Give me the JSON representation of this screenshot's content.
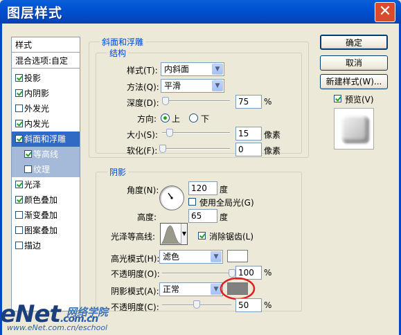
{
  "window": {
    "title": "图层样式",
    "close_glyph": "✕"
  },
  "left_list": {
    "header": "样式",
    "blend": "混合选项:自定",
    "items": [
      {
        "label": "投影",
        "checked": true,
        "state": "normal"
      },
      {
        "label": "内阴影",
        "checked": true,
        "state": "normal"
      },
      {
        "label": "外发光",
        "checked": false,
        "state": "normal"
      },
      {
        "label": "内发光",
        "checked": true,
        "state": "normal"
      },
      {
        "label": "斜面和浮雕",
        "checked": true,
        "state": "selected"
      },
      {
        "label": "等高线",
        "checked": true,
        "state": "sub"
      },
      {
        "label": "纹理",
        "checked": false,
        "state": "sub"
      },
      {
        "label": "光泽",
        "checked": true,
        "state": "normal"
      },
      {
        "label": "颜色叠加",
        "checked": true,
        "state": "normal"
      },
      {
        "label": "渐变叠加",
        "checked": false,
        "state": "normal"
      },
      {
        "label": "图案叠加",
        "checked": false,
        "state": "normal"
      },
      {
        "label": "描边",
        "checked": false,
        "state": "normal"
      }
    ]
  },
  "bevel": {
    "group_title": "斜面和浮雕",
    "structure_title": "结构",
    "style_label": "样式(T):",
    "style_value": "内斜面",
    "technique_label": "方法(Q):",
    "technique_value": "平滑",
    "depth_label": "深度(D):",
    "depth_value": "75",
    "depth_unit": "%",
    "direction_label": "方向:",
    "dir_up": "上",
    "dir_down": "下",
    "size_label": "大小(S):",
    "size_value": "15",
    "size_unit": "像素",
    "soften_label": "软化(F):",
    "soften_value": "0",
    "soften_unit": "像素"
  },
  "shading": {
    "title": "阴影",
    "angle_label": "角度(N):",
    "angle_value": "120",
    "angle_unit": "度",
    "global_light_label": "使用全局光(G)",
    "altitude_label": "高度:",
    "altitude_value": "65",
    "altitude_unit": "度",
    "gloss_label": "光泽等高线:",
    "antialias_label": "消除锯齿(L)",
    "highlight_mode_label": "高光模式(H):",
    "highlight_mode_value": "滤色",
    "highlight_opacity_label": "不透明度(O):",
    "highlight_opacity_value": "100",
    "shadow_mode_label": "阴影模式(A):",
    "shadow_mode_value": "正常",
    "shadow_opacity_label": "不透明度(C):",
    "shadow_opacity_value": "50",
    "percent": "%",
    "highlight_color": "#ffffff",
    "shadow_color": "#808080",
    "annotation_color": "#e02020"
  },
  "buttons": {
    "ok": "确定",
    "cancel": "取消",
    "new_style": "新建样式(W)...",
    "preview_label": "预览(V)"
  },
  "watermark": {
    "logo": "eNet",
    "suffix": ".com.cn",
    "cn": "网络学院",
    "url": "www.eNet.com.cn/eschool"
  }
}
